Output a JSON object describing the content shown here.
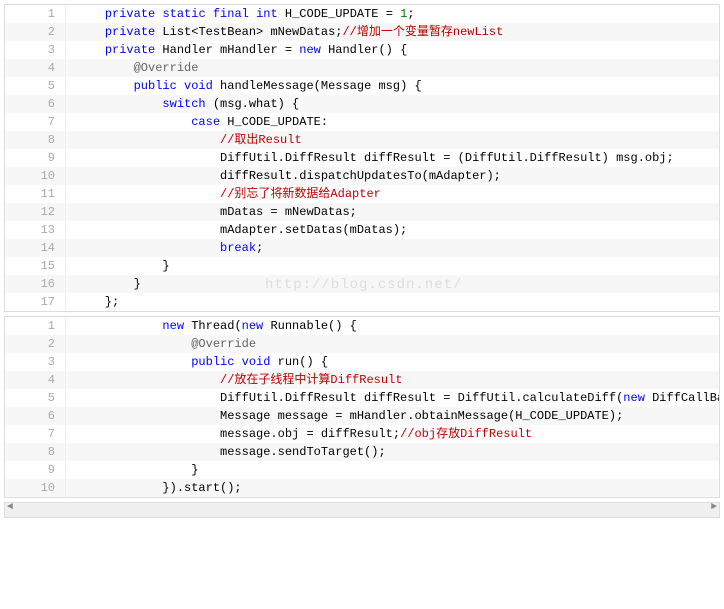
{
  "watermark": "http://blog.csdn.net/",
  "block1": {
    "lines": [
      {
        "n": "1",
        "tokens": [
          {
            "t": "    "
          },
          {
            "t": "private",
            "c": "kw"
          },
          {
            "t": " "
          },
          {
            "t": "static",
            "c": "kw"
          },
          {
            "t": " "
          },
          {
            "t": "final",
            "c": "kw"
          },
          {
            "t": " "
          },
          {
            "t": "int",
            "c": "kw"
          },
          {
            "t": " H_CODE_UPDATE = "
          },
          {
            "t": "1",
            "c": "num"
          },
          {
            "t": ";"
          }
        ]
      },
      {
        "n": "2",
        "tokens": [
          {
            "t": "    "
          },
          {
            "t": "private",
            "c": "kw"
          },
          {
            "t": " List<TestBean> mNewDatas;"
          },
          {
            "t": "//增加一个变量暂存newList",
            "c": "cmt-red"
          }
        ]
      },
      {
        "n": "3",
        "tokens": [
          {
            "t": "    "
          },
          {
            "t": "private",
            "c": "kw"
          },
          {
            "t": " Handler mHandler = "
          },
          {
            "t": "new",
            "c": "kw"
          },
          {
            "t": " Handler() {"
          }
        ]
      },
      {
        "n": "4",
        "tokens": [
          {
            "t": "        "
          },
          {
            "t": "@Override",
            "c": "ann"
          }
        ]
      },
      {
        "n": "5",
        "tokens": [
          {
            "t": "        "
          },
          {
            "t": "public",
            "c": "kw"
          },
          {
            "t": " "
          },
          {
            "t": "void",
            "c": "kw"
          },
          {
            "t": " handleMessage(Message msg) {"
          }
        ]
      },
      {
        "n": "6",
        "tokens": [
          {
            "t": "            "
          },
          {
            "t": "switch",
            "c": "kw"
          },
          {
            "t": " (msg.what) {"
          }
        ]
      },
      {
        "n": "7",
        "tokens": [
          {
            "t": "                "
          },
          {
            "t": "case",
            "c": "kw"
          },
          {
            "t": " H_CODE_UPDATE:"
          }
        ]
      },
      {
        "n": "8",
        "tokens": [
          {
            "t": "                    "
          },
          {
            "t": "//取出Result",
            "c": "cmt-red"
          }
        ]
      },
      {
        "n": "9",
        "tokens": [
          {
            "t": "                    DiffUtil.DiffResult diffResult = (DiffUtil.DiffResult) msg.obj;"
          }
        ]
      },
      {
        "n": "10",
        "tokens": [
          {
            "t": "                    diffResult.dispatchUpdatesTo(mAdapter);"
          }
        ]
      },
      {
        "n": "11",
        "tokens": [
          {
            "t": "                    "
          },
          {
            "t": "//别忘了将新数据给Adapter",
            "c": "cmt-red"
          }
        ]
      },
      {
        "n": "12",
        "tokens": [
          {
            "t": "                    mDatas = mNewDatas;"
          }
        ]
      },
      {
        "n": "13",
        "tokens": [
          {
            "t": "                    mAdapter.setDatas(mDatas);"
          }
        ]
      },
      {
        "n": "14",
        "tokens": [
          {
            "t": "                    "
          },
          {
            "t": "break",
            "c": "kw"
          },
          {
            "t": ";"
          }
        ]
      },
      {
        "n": "15",
        "tokens": [
          {
            "t": "            }"
          }
        ]
      },
      {
        "n": "16",
        "tokens": [
          {
            "t": "        }"
          }
        ]
      },
      {
        "n": "17",
        "tokens": [
          {
            "t": "    };"
          }
        ]
      }
    ]
  },
  "block2": {
    "lines": [
      {
        "n": "1",
        "tokens": [
          {
            "t": "            "
          },
          {
            "t": "new",
            "c": "kw"
          },
          {
            "t": " Thread("
          },
          {
            "t": "new",
            "c": "kw"
          },
          {
            "t": " Runnable() {"
          }
        ]
      },
      {
        "n": "2",
        "tokens": [
          {
            "t": "                "
          },
          {
            "t": "@Override",
            "c": "ann"
          }
        ]
      },
      {
        "n": "3",
        "tokens": [
          {
            "t": "                "
          },
          {
            "t": "public",
            "c": "kw"
          },
          {
            "t": " "
          },
          {
            "t": "void",
            "c": "kw"
          },
          {
            "t": " run() {"
          }
        ]
      },
      {
        "n": "4",
        "tokens": [
          {
            "t": "                    "
          },
          {
            "t": "//放在子线程中计算DiffResult",
            "c": "cmt-red"
          }
        ]
      },
      {
        "n": "5",
        "tokens": [
          {
            "t": "                    DiffUtil.DiffResult diffResult = DiffUtil.calculateDiff("
          },
          {
            "t": "new",
            "c": "kw"
          },
          {
            "t": " DiffCallBack"
          }
        ]
      },
      {
        "n": "6",
        "tokens": [
          {
            "t": "                    Message message = mHandler.obtainMessage(H_CODE_UPDATE);"
          }
        ]
      },
      {
        "n": "7",
        "tokens": [
          {
            "t": "                    message.obj = diffResult;"
          },
          {
            "t": "//obj存放DiffResult",
            "c": "cmt-red"
          }
        ]
      },
      {
        "n": "8",
        "tokens": [
          {
            "t": "                    message.sendToTarget();"
          }
        ]
      },
      {
        "n": "9",
        "tokens": [
          {
            "t": "                }"
          }
        ]
      },
      {
        "n": "10",
        "tokens": [
          {
            "t": "            }).start();"
          }
        ]
      }
    ]
  }
}
